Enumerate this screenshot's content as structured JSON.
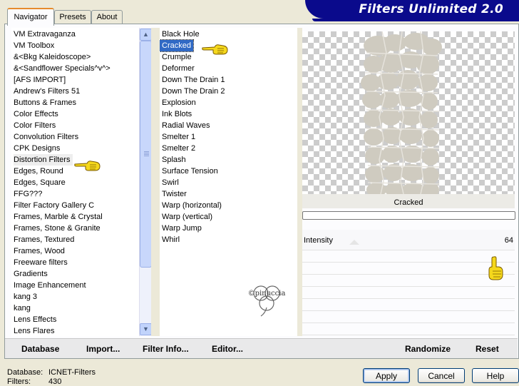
{
  "window": {
    "title": "Filters Unlimited 2.0"
  },
  "tabs": [
    {
      "label": "Navigator",
      "active": true
    },
    {
      "label": "Presets",
      "active": false
    },
    {
      "label": "About",
      "active": false
    }
  ],
  "categories": {
    "items": [
      "VM Extravaganza",
      "VM Toolbox",
      "&<Bkg Kaleidoscope>",
      "&<Sandflower Specials^v^>",
      "[AFS IMPORT]",
      "Andrew's Filters 51",
      "Buttons & Frames",
      "Color Effects",
      "Color Filters",
      "Convolution Filters",
      "CPK Designs",
      "Distortion Filters",
      "Edges, Round",
      "Edges, Square",
      "FFG???",
      "Filter Factory Gallery C",
      "Frames, Marble & Crystal",
      "Frames, Stone & Granite",
      "Frames, Textured",
      "Frames, Wood",
      "Freeware filters",
      "Gradients",
      "Image Enhancement",
      "kang 3",
      "kang",
      "Lens Effects",
      "Lens Flares"
    ],
    "selected": "Distortion Filters"
  },
  "filters": {
    "items": [
      "Black Hole",
      "Cracked",
      "Crumple",
      "Deformer",
      "Down The Drain 1",
      "Down The Drain 2",
      "Explosion",
      "Ink Blots",
      "Radial Waves",
      "Smelter 1",
      "Smelter 2",
      "Splash",
      "Surface Tension",
      "Swirl",
      "Twister",
      "Warp (horizontal)",
      "Warp (vertical)",
      "Warp Jump",
      "Whirl"
    ],
    "selected": "Cracked"
  },
  "watermark": {
    "text": "©pinuccia"
  },
  "preview": {
    "filter_name": "Cracked"
  },
  "params": {
    "intensity_label": "Intensity",
    "intensity_value": "64"
  },
  "buttons": {
    "database": "Database",
    "import": "Import...",
    "filter_info": "Filter Info...",
    "editor": "Editor...",
    "randomize": "Randomize",
    "reset": "Reset",
    "apply": "Apply",
    "cancel": "Cancel",
    "help": "Help"
  },
  "status": {
    "database_label": "Database:",
    "database_value": "ICNET-Filters",
    "filters_label": "Filters:",
    "filters_value": "430"
  },
  "colors": {
    "selection": "#316ac5",
    "banner": "#0a0a8c",
    "tab_accent": "#e68b2c"
  }
}
